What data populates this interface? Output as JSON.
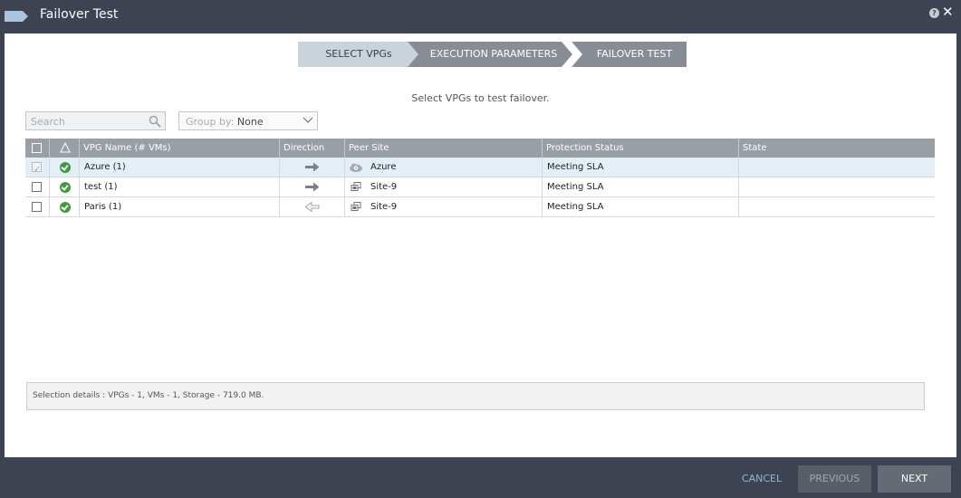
{
  "window": {
    "title": "Failover Test",
    "logo_icon": "tag-logo-icon",
    "help_icon": "help-icon",
    "close_icon": "close-icon",
    "help_glyph": "?",
    "close_glyph": "✕"
  },
  "wizard": {
    "steps": [
      {
        "label": "SELECT VPGs",
        "active": true
      },
      {
        "label": "EXECUTION PARAMETERS",
        "active": false
      },
      {
        "label": "FAILOVER TEST",
        "active": false
      }
    ],
    "instruction": "Select VPGs to test failover."
  },
  "search": {
    "placeholder": "Search",
    "icon": "search-icon"
  },
  "groupby": {
    "label": "Group by: ",
    "value": "None",
    "icon": "chevron-down-icon"
  },
  "table": {
    "columns": [
      "",
      "",
      "VPG Name (# VMs)",
      "Direction",
      "Peer Site",
      "Protection Status",
      "State"
    ],
    "rows": [
      {
        "selected": true,
        "status_icon": "check-circle-icon",
        "name": "Azure (1)",
        "direction": "outgoing-arrow-icon",
        "peer_icon": "cloud-icon",
        "peer_site": "Azure",
        "protection_status": "Meeting SLA",
        "state": ""
      },
      {
        "selected": false,
        "status_icon": "check-circle-icon",
        "name": "test (1)",
        "direction": "outgoing-arrow-icon",
        "peer_icon": "site-icon",
        "peer_site": "Site-9",
        "protection_status": "Meeting SLA",
        "state": ""
      },
      {
        "selected": false,
        "status_icon": "check-circle-icon",
        "name": "Paris (1)",
        "direction": "incoming-arrow-icon",
        "peer_icon": "site-icon",
        "peer_site": "Site-9",
        "protection_status": "Meeting SLA",
        "state": ""
      }
    ]
  },
  "selection_details": "Selection details :  VPGs  -  1, VMs  -  1, Storage  -  719.0 MB.",
  "footer": {
    "cancel": "CANCEL",
    "previous": "PREVIOUS",
    "next": "NEXT"
  },
  "colors": {
    "titlebar": "#3d4350",
    "active_step": "#c9d3dc",
    "inactive_step": "#878c95",
    "table_header": "#9a9ea5",
    "selected_row": "#e4eef6",
    "status_ok": "#3e9b3c",
    "link": "#8fb6d8"
  }
}
